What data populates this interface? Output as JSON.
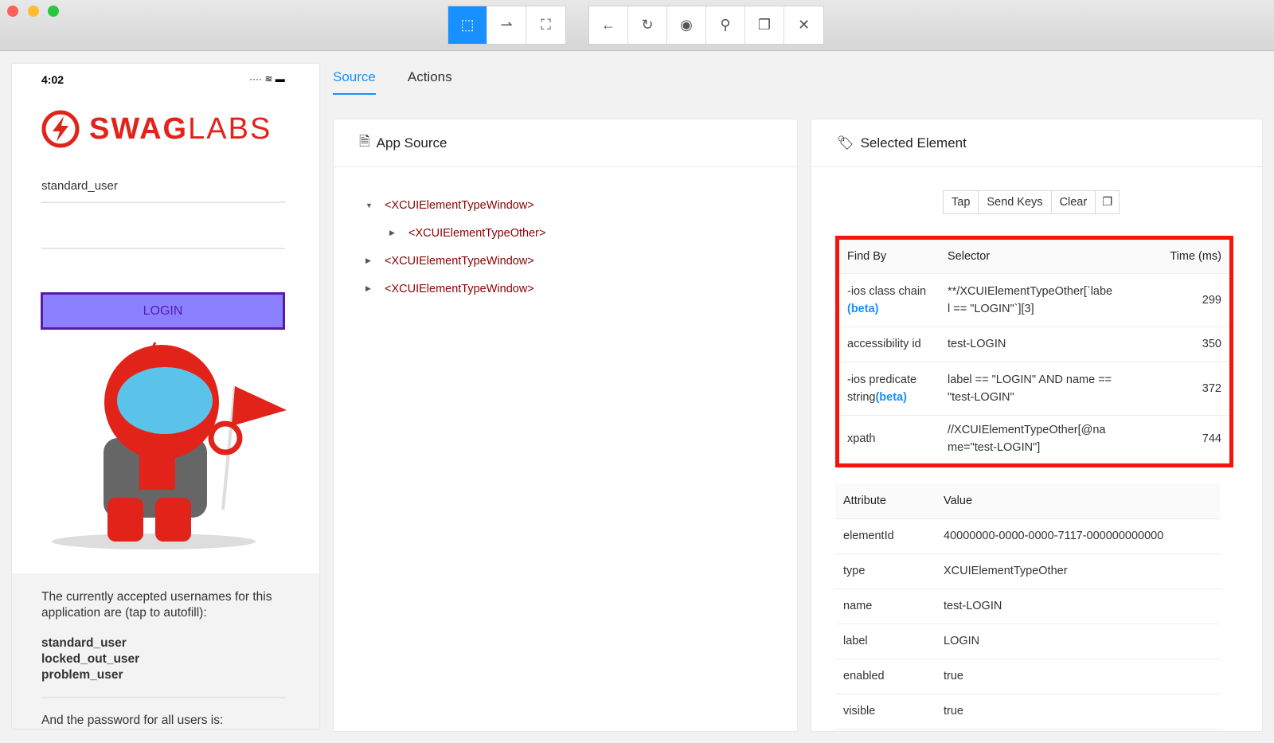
{
  "toolbar": {
    "groups": [
      [
        {
          "icon": "select-element-icon",
          "active": true
        },
        {
          "icon": "swipe-icon"
        },
        {
          "icon": "tap-coordinates-icon"
        }
      ],
      [
        {
          "icon": "back-icon"
        },
        {
          "icon": "refresh-icon"
        },
        {
          "icon": "eye-icon"
        },
        {
          "icon": "search-icon"
        },
        {
          "icon": "copy-xml-icon"
        },
        {
          "icon": "close-icon"
        }
      ]
    ],
    "accent": "#1890ff"
  },
  "phone": {
    "time": "4:02",
    "brand_bold": "SWAG",
    "brand_light": "LABS",
    "username": "standard_user",
    "password": "",
    "login_label": "LOGIN",
    "info": "The currently accepted usernames for this application are (tap to autofill):",
    "usernames": [
      "standard_user",
      "locked_out_user",
      "problem_user"
    ],
    "password_info": "And the password for all users is:"
  },
  "tabs": [
    {
      "label": "Source",
      "active": true
    },
    {
      "label": "Actions"
    }
  ],
  "source": {
    "title": "App Source",
    "nodes": [
      {
        "label": "<XCUIElementTypeWindow>",
        "depth": 0,
        "expanded": true
      },
      {
        "label": "<XCUIElementTypeOther>",
        "depth": 1,
        "expanded": false
      },
      {
        "label": "<XCUIElementTypeWindow>",
        "depth": 0,
        "expanded": false
      },
      {
        "label": "<XCUIElementTypeWindow>",
        "depth": 0,
        "expanded": false
      }
    ]
  },
  "selected": {
    "title": "Selected Element",
    "actions": [
      "Tap",
      "Send Keys",
      "Clear"
    ],
    "find_headers": [
      "Find By",
      "Selector",
      "Time (ms)"
    ],
    "find_rows": [
      {
        "by": "-ios class chain ",
        "beta": "(beta)",
        "selector": "**/XCUIElementTypeOther[`label == \"LOGIN\"`][3]",
        "time": "299"
      },
      {
        "by": "accessibility id",
        "beta": "",
        "selector": "test-LOGIN",
        "time": "350"
      },
      {
        "by": "-ios predicate string",
        "beta": "(beta)",
        "selector": "label == \"LOGIN\" AND name == \"test-LOGIN\"",
        "time": "372"
      },
      {
        "by": "xpath",
        "beta": "",
        "selector": "//XCUIElementTypeOther[@name=\"test-LOGIN\"]",
        "time": "744"
      }
    ],
    "attr_headers": [
      "Attribute",
      "Value"
    ],
    "attrs": [
      [
        "elementId",
        "40000000-0000-0000-7117-000000000000"
      ],
      [
        "type",
        "XCUIElementTypeOther"
      ],
      [
        "name",
        "test-LOGIN"
      ],
      [
        "label",
        "LOGIN"
      ],
      [
        "enabled",
        "true"
      ],
      [
        "visible",
        "true"
      ]
    ]
  }
}
